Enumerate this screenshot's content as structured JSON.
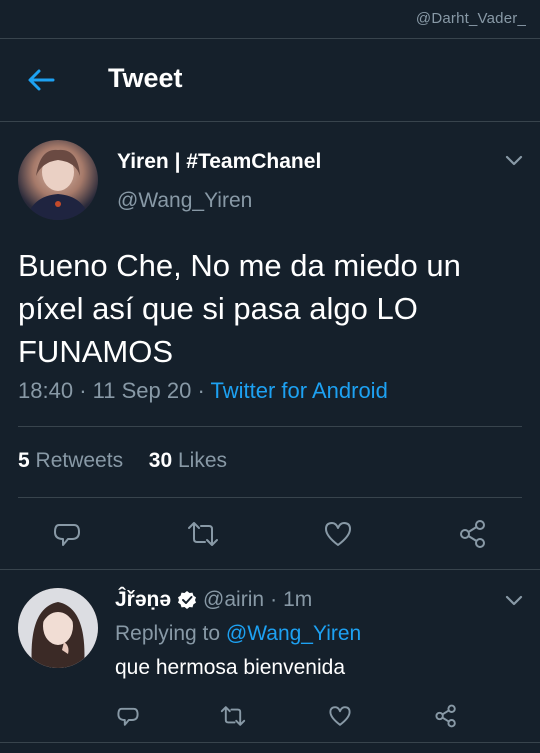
{
  "watermark": "@Darht_Vader_",
  "header": {
    "title": "Tweet"
  },
  "tweet": {
    "display_name": "Yiren | #TeamChanel",
    "handle": "@Wang_Yiren",
    "text": "Bueno Che, No me da miedo un píxel así que si pasa algo LO FUNAMOS",
    "time": "18:40",
    "date": "11 Sep 20",
    "dot": "·",
    "client": "Twitter for Android",
    "retweets_count": "5",
    "retweets_label": "Retweets",
    "likes_count": "30",
    "likes_label": "Likes"
  },
  "reply": {
    "display_name": "Ĵřəṇə",
    "handle": "@airin",
    "dot": "·",
    "age": "1m",
    "replying_label": "Replying to",
    "replying_to": "@Wang_Yiren",
    "text": "que hermosa bienvenida"
  },
  "icons": {
    "back": "arrow-left-icon",
    "reply": "comment-icon",
    "retweet": "retweet-icon",
    "like": "heart-icon",
    "share": "share-icon",
    "menu": "chevron-down-icon",
    "verified": "verified-badge-icon"
  },
  "colors": {
    "background": "#15202b",
    "accent": "#1da1f2",
    "secondary_text": "#8899a6",
    "divider": "#38444d"
  }
}
